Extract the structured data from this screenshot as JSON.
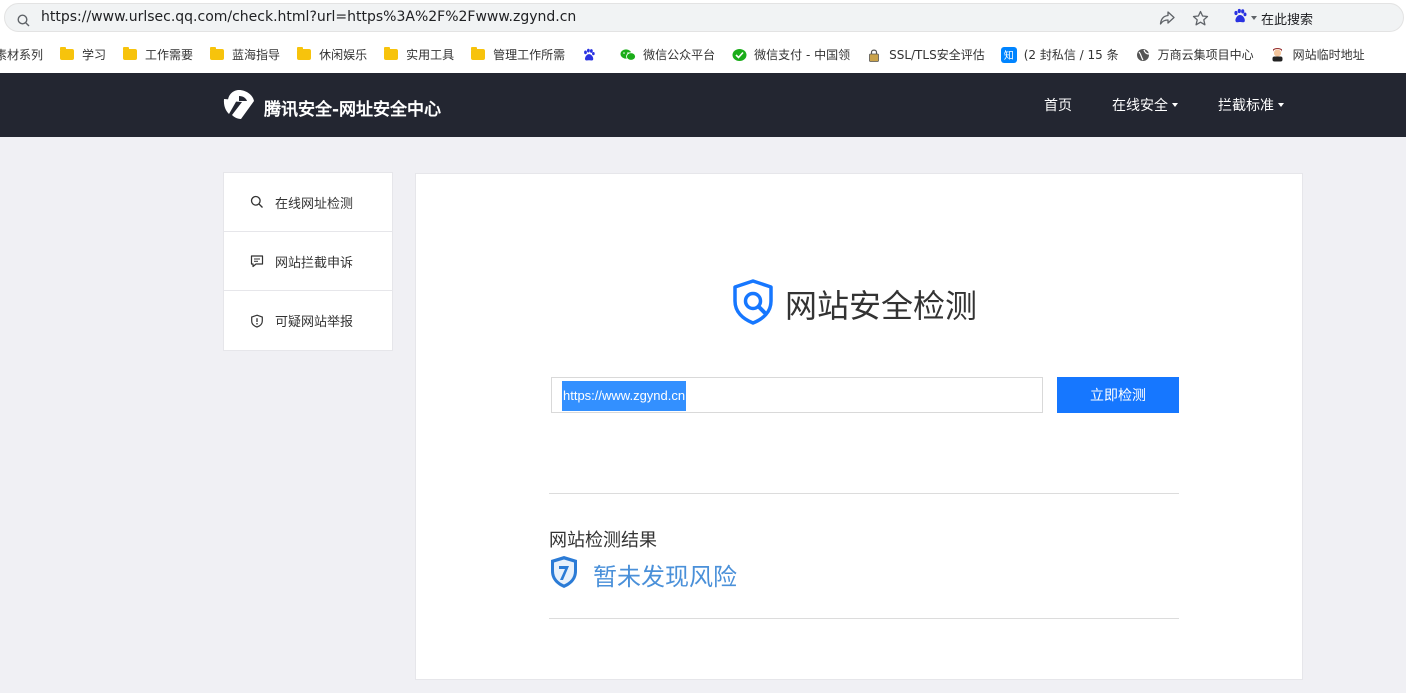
{
  "browser": {
    "url": "https://www.urlsec.qq.com/check.html?url=https%3A%2F%2Fwww.zgynd.cn",
    "search_engine_label": "在此搜索"
  },
  "bookmarks": [
    {
      "label": "素材系列",
      "icon": "folder-icon"
    },
    {
      "label": "学习",
      "icon": "folder-icon"
    },
    {
      "label": "工作需要",
      "icon": "folder-icon"
    },
    {
      "label": "蓝海指导",
      "icon": "folder-icon"
    },
    {
      "label": "休闲娱乐",
      "icon": "folder-icon"
    },
    {
      "label": "实用工具",
      "icon": "folder-icon"
    },
    {
      "label": "管理工作所需",
      "icon": "folder-icon"
    },
    {
      "label": "",
      "icon": "baidu-paw-icon"
    },
    {
      "label": "微信公众平台",
      "icon": "wechat-icon"
    },
    {
      "label": "微信支付 - 中国领",
      "icon": "wechat-pay-icon"
    },
    {
      "label": "SSL/TLS安全评估",
      "icon": "lock-icon"
    },
    {
      "label": "(2 封私信 / 15 条",
      "icon": "zhihu-icon"
    },
    {
      "label": "万商云集项目中心",
      "icon": "globe-icon"
    },
    {
      "label": "网站临时地址",
      "icon": "avatar-icon"
    }
  ],
  "site": {
    "brand": "腾讯安全-网址安全中心",
    "nav": [
      {
        "label": "首页",
        "dropdown": false
      },
      {
        "label": "在线安全",
        "dropdown": true
      },
      {
        "label": "拦截标准",
        "dropdown": true
      }
    ]
  },
  "sidebar": {
    "items": [
      {
        "label": "在线网址检测",
        "icon": "search-icon"
      },
      {
        "label": "网站拦截申诉",
        "icon": "message-icon"
      },
      {
        "label": "可疑网站举报",
        "icon": "shield-icon"
      }
    ]
  },
  "main": {
    "title": "网站安全检测",
    "input_value": "https://www.zgynd.cn",
    "check_button": "立即检测",
    "result_label": "网站检测结果",
    "result_text": "暂未发现风险"
  },
  "colors": {
    "header_bg": "#232631",
    "accent": "#1677ff",
    "result": "#4a90d9",
    "selection": "#3390ff"
  }
}
